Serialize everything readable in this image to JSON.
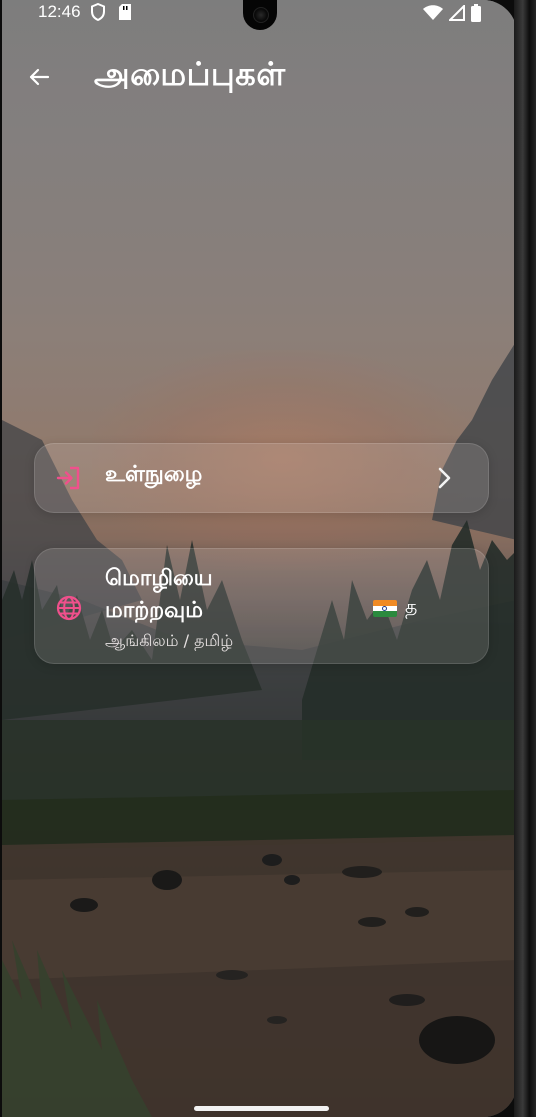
{
  "status_bar": {
    "time": "12:46",
    "icons": [
      "shield-icon",
      "sd-card-icon",
      "wifi-icon",
      "signal-icon",
      "battery-icon"
    ]
  },
  "app_bar": {
    "back_icon": "arrow-left-icon",
    "title": "அமைப்புகள்"
  },
  "settings": {
    "login": {
      "icon": "login-icon",
      "label": "உள்நுழை",
      "chevron_icon": "chevron-right-icon"
    },
    "language": {
      "icon": "globe-icon",
      "label": "மொழியை மாற்றவும்",
      "subtitle": "ஆங்கிலம் / தமிழ்",
      "current_flag": "india-flag-icon",
      "current_value": "த"
    }
  },
  "colors": {
    "accent_pink": "#f0508c",
    "text": "#ffffff"
  }
}
